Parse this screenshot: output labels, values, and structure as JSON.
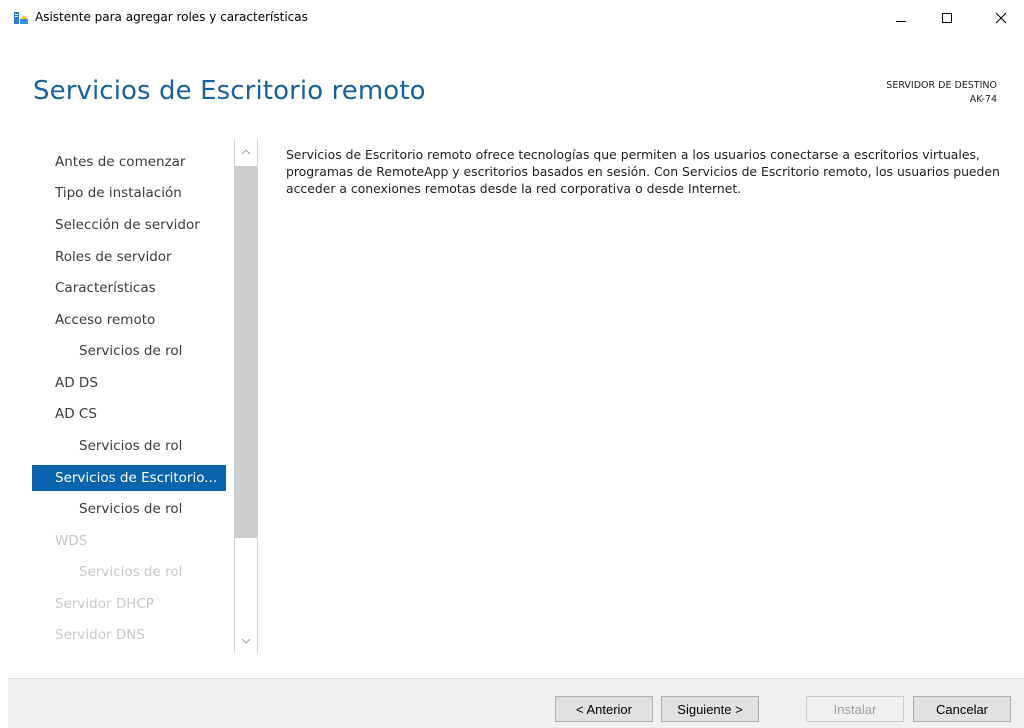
{
  "window": {
    "title": "Asistente para agregar roles y características",
    "icons": {
      "app": "server-manager-icon",
      "minimize": "minimize-icon",
      "maximize": "maximize-icon",
      "close": "close-icon"
    }
  },
  "header": {
    "title": "Servicios de Escritorio remoto",
    "destination_label": "SERVIDOR DE DESTINO",
    "destination_server": "AK-74"
  },
  "sidebar": {
    "items": [
      {
        "label": "Antes de comenzar",
        "level": 0,
        "state": "normal"
      },
      {
        "label": "Tipo de instalación",
        "level": 0,
        "state": "normal"
      },
      {
        "label": "Selección de servidor",
        "level": 0,
        "state": "normal"
      },
      {
        "label": "Roles de servidor",
        "level": 0,
        "state": "normal"
      },
      {
        "label": "Características",
        "level": 0,
        "state": "normal"
      },
      {
        "label": "Acceso remoto",
        "level": 0,
        "state": "normal"
      },
      {
        "label": "Servicios de rol",
        "level": 1,
        "state": "normal"
      },
      {
        "label": "AD DS",
        "level": 0,
        "state": "normal"
      },
      {
        "label": "AD CS",
        "level": 0,
        "state": "normal"
      },
      {
        "label": "Servicios de rol",
        "level": 1,
        "state": "normal"
      },
      {
        "label": "Servicios de Escritorio...",
        "level": 0,
        "state": "selected"
      },
      {
        "label": "Servicios de rol",
        "level": 1,
        "state": "normal"
      },
      {
        "label": "WDS",
        "level": 0,
        "state": "disabled"
      },
      {
        "label": "Servicios de rol",
        "level": 1,
        "state": "disabled"
      },
      {
        "label": "Servidor DHCP",
        "level": 0,
        "state": "disabled"
      },
      {
        "label": "Servidor DNS",
        "level": 0,
        "state": "disabled"
      }
    ]
  },
  "content": {
    "description": "Servicios de Escritorio remoto ofrece tecnologías que permiten a los usuarios conectarse a escritorios virtuales, programas de RemoteApp y escritorios basados en sesión. Con Servicios de Escritorio remoto, los usuarios pueden acceder a conexiones remotas desde la red corporativa o desde Internet."
  },
  "footer": {
    "previous_label": "< Anterior",
    "next_label": "Siguiente >",
    "install_label": "Instalar",
    "cancel_label": "Cancelar",
    "install_enabled": false
  },
  "colors": {
    "accent": "#0a64ad",
    "title": "#1a5f9f",
    "disabled_text": "#c8c8c8",
    "footer_bg": "#f0f0f0"
  }
}
